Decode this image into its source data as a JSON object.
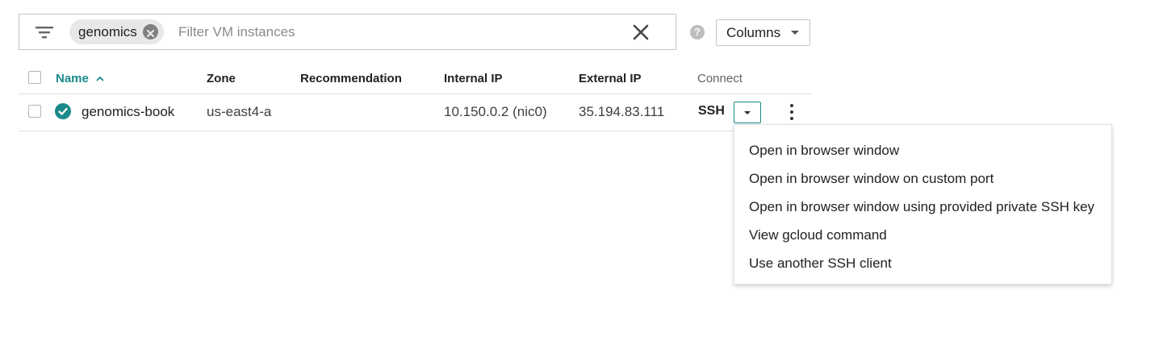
{
  "filter": {
    "chip_label": "genomics",
    "placeholder": "Filter VM instances",
    "value": ""
  },
  "toolbar": {
    "help_label": "?",
    "columns_label": "Columns"
  },
  "table": {
    "columns": {
      "name": "Name",
      "name_sort_indicator": "^",
      "zone": "Zone",
      "recommendation": "Recommendation",
      "internal_ip": "Internal IP",
      "external_ip": "External IP",
      "connect": "Connect"
    },
    "rows": [
      {
        "status": "running",
        "name": "genomics-book",
        "zone": "us-east4-a",
        "recommendation": "",
        "internal_ip": "10.150.0.2",
        "internal_ip_nic": "(nic0)",
        "external_ip": "35.194.83.111",
        "connect": "SSH"
      }
    ]
  },
  "ssh_menu": {
    "items": [
      "Open in browser window",
      "Open in browser window on custom port",
      "Open in browser window using provided private SSH key",
      "View gcloud command",
      "Use another SSH client"
    ]
  },
  "icons": {
    "filter": "filter-lines-icon",
    "chip_remove": "close-circle-icon",
    "clear": "close-icon",
    "help": "help-circle-icon",
    "status": "check-circle-icon",
    "more": "more-vert-icon"
  },
  "colors": {
    "accent": "#1a8a8a",
    "border": "#c6c6c6",
    "divider": "#e0e0e0"
  }
}
